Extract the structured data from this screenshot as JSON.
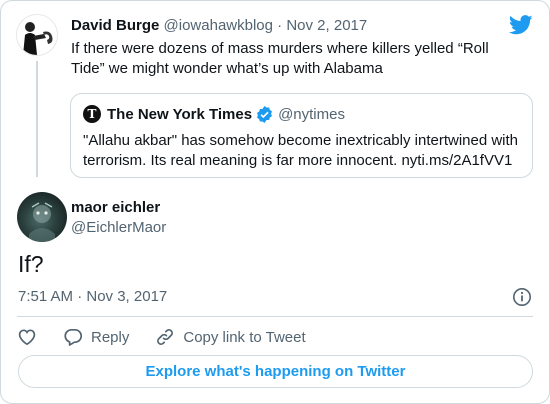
{
  "parent": {
    "name": "David Burge",
    "handle": "@iowahawkblog",
    "separator": "·",
    "date": "Nov 2, 2017",
    "text": "If there were dozens of mass murders where killers yelled “Roll Tide” we might wonder what’s up with Alabama"
  },
  "quote": {
    "logo_glyph": "T",
    "name": "The New York Times",
    "handle": "@nytimes",
    "text": "\"Allahu akbar\" has somehow become inextricably intertwined with terrorism. Its real meaning is far more innocent. nyti.ms/2A1fVV1"
  },
  "main": {
    "name": "maor eichler",
    "handle": "@EichlerMaor",
    "text": "If?",
    "timestamp": "7:51 AM · Nov 3, 2017"
  },
  "actions": {
    "reply_label": "Reply",
    "copy_label": "Copy link to Tweet"
  },
  "explore_label": "Explore what's happening on Twitter",
  "colors": {
    "accent": "#1d9bf0",
    "text": "#0f1419",
    "secondary": "#536471",
    "border": "#cfd9de"
  },
  "icons": [
    "twitter-bird-icon",
    "verified-badge-icon",
    "info-icon",
    "heart-icon",
    "reply-icon",
    "link-icon"
  ]
}
